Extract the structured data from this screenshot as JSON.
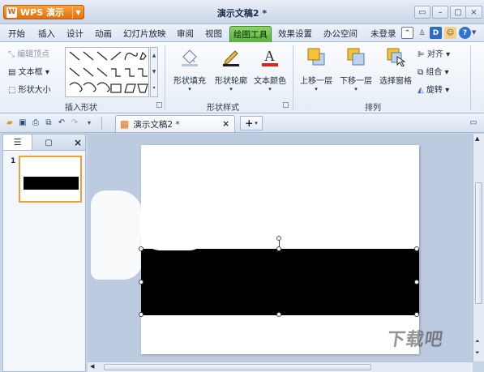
{
  "app": {
    "name": "WPS 演示",
    "logo_letter": "W",
    "doc_title": "演示文稿2 *"
  },
  "window_controls": [
    "▭",
    "–",
    "▢",
    "×"
  ],
  "menu": {
    "items": [
      "开始",
      "插入",
      "设计",
      "动画",
      "幻灯片放映",
      "审阅",
      "视图",
      "绘图工具",
      "效果设置",
      "办公空间",
      "未登录"
    ],
    "active": "绘图工具"
  },
  "ribbon": {
    "insert_shape": {
      "edit_vertex": "编辑顶点",
      "text_box": "文本框",
      "shape_size": "形状大小",
      "group_label": "插入形状"
    },
    "shape_style": {
      "fill": "形状填充",
      "outline": "形状轮廓",
      "text_color": "文本颜色",
      "group_label": "形状样式"
    },
    "arrange": {
      "bring_forward": "上移一层",
      "send_backward": "下移一层",
      "selection_pane": "选择窗格",
      "align": "对齐",
      "group": "组合",
      "rotate": "旋转",
      "group_label": "排列"
    }
  },
  "toolbar": {
    "doc_tab": "演示文稿2 *",
    "close": "×",
    "add": "+"
  },
  "panel": {
    "slide_number": "1"
  },
  "watermark": "下载吧",
  "colors": {
    "accent_green": "#59b33c",
    "wps_orange": "#e46f0e",
    "shape_fill": "#000000"
  }
}
